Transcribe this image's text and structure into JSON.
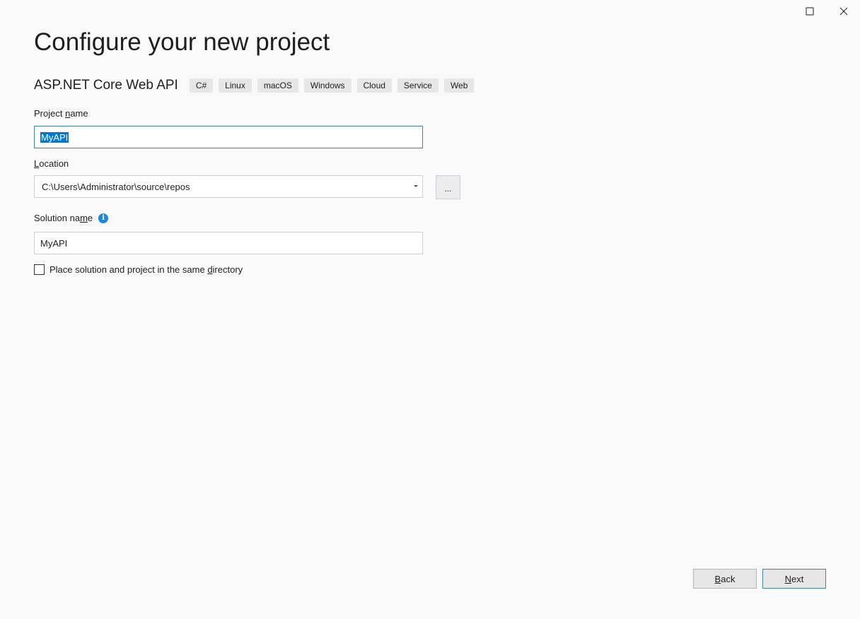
{
  "window_controls": {
    "maximize_icon": "maximize-icon",
    "close_icon": "close-icon"
  },
  "page": {
    "title": "Configure your new project"
  },
  "template": {
    "name": "ASP.NET Core Web API",
    "tags": [
      "C#",
      "Linux",
      "macOS",
      "Windows",
      "Cloud",
      "Service",
      "Web"
    ]
  },
  "project_name": {
    "label_pre": "Project ",
    "label_accel": "n",
    "label_post": "ame",
    "value": "MyAPI"
  },
  "location": {
    "label_accel": "L",
    "label_post": "ocation",
    "value": "C:\\Users\\Administrator\\source\\repos",
    "browse_label": "..."
  },
  "solution_name": {
    "label_pre": "Solution na",
    "label_accel": "m",
    "label_post": "e",
    "value": "MyAPI",
    "info_icon": "info-icon"
  },
  "same_directory": {
    "label_pre": "Place solution and project in the same ",
    "label_accel": "d",
    "label_post": "irectory",
    "checked": false
  },
  "footer": {
    "back_accel": "B",
    "back_post": "ack",
    "next_accel": "N",
    "next_post": "ext"
  },
  "colors": {
    "background": "#f9f9f9",
    "focus_border": "#3d83b4",
    "selection": "#0078d7",
    "info_icon": "#1a8ad8"
  }
}
